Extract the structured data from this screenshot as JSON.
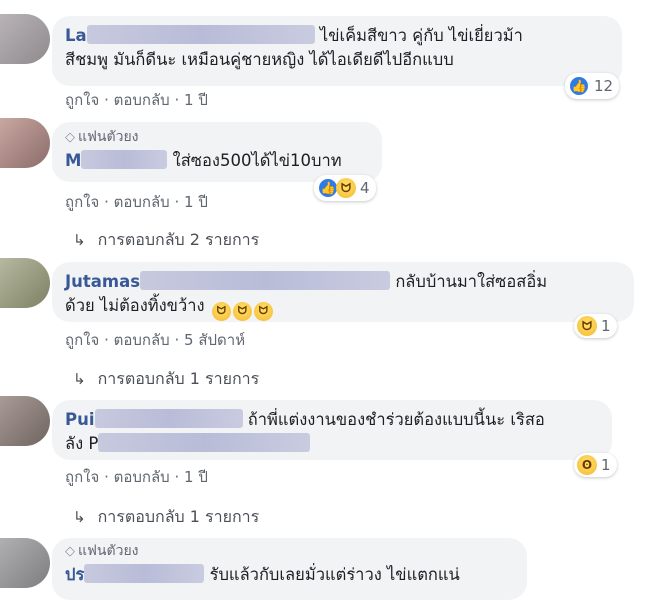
{
  "comments": [
    {
      "name": "La",
      "text_line1": "ไข่เค็มสีขาว คู่กับ ไข่เยี่ยวม้า",
      "text_line2": "สีชมพู มันก็ดีนะ เหมือนคู่ชายหญิง ได้ไอเดียดีไปอีกแบบ",
      "reaction_count": "12",
      "reaction_icons": [
        "like-icon"
      ],
      "actions": {
        "like": "ถูกใจ",
        "reply": "ตอบกลับ",
        "time": "1 ปี"
      }
    },
    {
      "badge": "แฟนตัวยง",
      "name": "M",
      "text_line1": "ใส่ซอง500ได้ไข่10บาท",
      "reaction_count": "4",
      "reaction_icons": [
        "like-icon",
        "haha-icon"
      ],
      "actions": {
        "like": "ถูกใจ",
        "reply": "ตอบกลับ",
        "time": "1 ปี"
      },
      "replies_label": "การตอบกลับ 2 รายการ"
    },
    {
      "name": "Jutamas",
      "text_line1": "กลับบ้านมาใส่ซอสอิ่ม",
      "text_line2": "ด้วย ไม่ต้องทิ้งขว้าง",
      "reaction_count": "1",
      "reaction_icons": [
        "haha-icon"
      ],
      "actions": {
        "like": "ถูกใจ",
        "reply": "ตอบกลับ",
        "time": "5 สัปดาห์"
      },
      "replies_label": "การตอบกลับ 1 รายการ"
    },
    {
      "name": "Pui",
      "text_line1": "ถ้าพี่แต่งงานของชำร่วยต้องแบบนี้นะ เริสอ",
      "text_line2": "ลัง P",
      "reaction_count": "1",
      "reaction_icons": [
        "wow-icon"
      ],
      "actions": {
        "like": "ถูกใจ",
        "reply": "ตอบกลับ",
        "time": "1 ปี"
      },
      "replies_label": "การตอบกลับ 1 รายการ"
    },
    {
      "badge": "แฟนตัวยง",
      "name": "ปร",
      "text_line1": "รับแล้วกับเลยมั่วแต่ร่าวง ไข่แตกแน่"
    }
  ],
  "separator": "·",
  "colors": {
    "name": "#385898",
    "bubble": "#f2f3f5",
    "like_blue": "#2e7ce3",
    "meta": "#606770"
  }
}
